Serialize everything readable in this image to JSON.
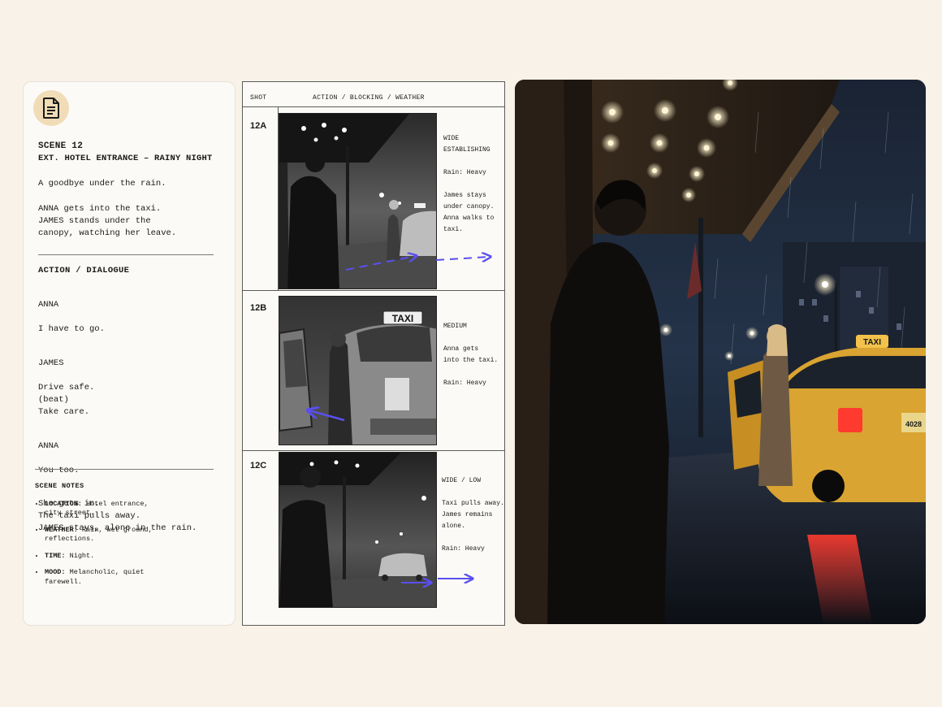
{
  "script": {
    "icon": "document-icon",
    "scene_number": "SCENE 12",
    "scene_heading": "EXT. HOTEL ENTRANCE – RAINY NIGHT",
    "logline": "A goodbye under the rain.",
    "action_1": "ANNA gets into the taxi.\nJAMES stands under the\ncanopy, watching her leave.",
    "section_label": "ACTION / DIALOGUE",
    "dialogue": [
      {
        "character": "ANNA",
        "lines": "I have to go."
      },
      {
        "character": "JAMES",
        "lines": "Drive safe.\n(beat)\nTake care."
      },
      {
        "character": "ANNA",
        "lines": "You too."
      }
    ],
    "action_2": "She gets in.\nThe taxi pulls away.\nJAMES stays, alone in the rain.",
    "notes_title": "SCENE NOTES",
    "notes": [
      {
        "label": "LOCATION:",
        "text": "Hotel entrance,\ncity street."
      },
      {
        "label": "WEATHER:",
        "text": "Rain, wet ground,\nreflections."
      },
      {
        "label": "TIME:",
        "text": "Night."
      },
      {
        "label": "MOOD:",
        "text": "Melancholic, quiet\nfarewell."
      }
    ]
  },
  "storyboard": {
    "header_shot": "SHOT",
    "header_action": "ACTION / BLOCKING / WEATHER",
    "shots": [
      {
        "id": "12A",
        "lines": [
          "WIDE",
          "ESTABLISHING",
          "",
          "Rain: Heavy",
          "",
          "James stays",
          "under canopy.",
          "Anna walks to",
          "taxi."
        ]
      },
      {
        "id": "12B",
        "lines": [
          "MEDIUM",
          "",
          "Anna gets",
          "into the taxi.",
          "",
          "Rain: Heavy"
        ]
      },
      {
        "id": "12C",
        "lines": [
          "WIDE / LOW",
          "",
          "Taxi pulls away.",
          "James remains",
          "alone.",
          "",
          "Rain: Heavy"
        ]
      }
    ],
    "taxi_sign": "TAXI"
  },
  "render": {
    "taxi_sign": "TAXI",
    "plate": "4028"
  },
  "colors": {
    "background": "#f9f2e8",
    "accent_arrow": "#5a4ff0",
    "badge": "#f1dcb8",
    "taxi": "#d9a431"
  }
}
